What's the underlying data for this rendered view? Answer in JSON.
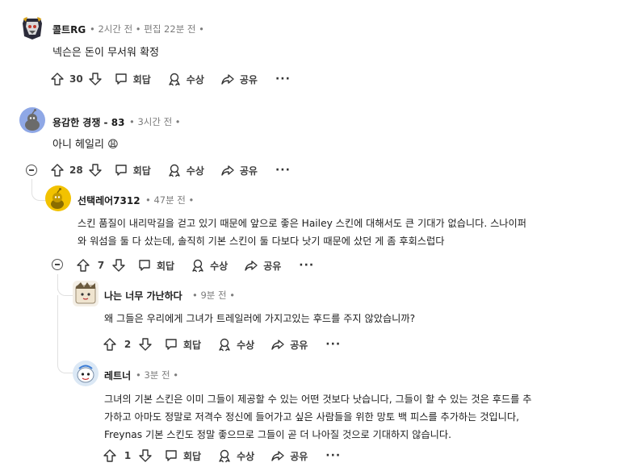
{
  "comments": [
    {
      "author": "콜트RG",
      "meta": "• 2시간 전 • 편집 22분 전 •",
      "body": "넥슨은 돈이 무서워 확정",
      "votes": "30",
      "reply": "회답",
      "award": "수상",
      "share": "공유",
      "more": "···"
    },
    {
      "author": "용감한 경쟁 - 83",
      "meta": "• 3시간 전 •",
      "body": "아니 헤일리 😩",
      "votes": "28",
      "reply": "회답",
      "award": "수상",
      "share": "공유",
      "more": "···"
    },
    {
      "author": "선택레어7312",
      "meta": "• 47분 전 •",
      "body_line1": "스킨 품질이 내리막길을 걷고 있기 때문에 앞으로 좋은 Hailey 스킨에 대해서도 큰 기대가 없습니다. 스나이퍼",
      "body_line2": "와 워섬을 둘 다 샀는데, 솔직히 기본 스킨이 둘 다보다 낫기 때문에 샀던 게 좀 후회스럽다",
      "votes": "7",
      "reply": "회답",
      "award": "수상",
      "share": "공유",
      "more": "···"
    },
    {
      "author": "나는 너무 가난하다",
      "meta": "• 9분 전 •",
      "body": "왜 그들은 우리에게 그녀가 트레일러에 가지고있는 후드를 주지 않았습니까?",
      "votes": "2",
      "reply": "회답",
      "award": "수상",
      "share": "공유",
      "more": "···"
    },
    {
      "author": "레트너",
      "meta": "• 3분 전 •",
      "body_line1": "그녀의 기본 스킨은 이미 그들이 제공할 수 있는 어떤 것보다 낫습니다, 그들이 할 수 있는 것은 후드를 추",
      "body_line2": "가하고 아마도 정말로 저격수 정신에 들어가고 싶은 사람들을 위한 망토 백 피스를 추가하는 것입니다,",
      "body_line3": "Freynas 기본 스킨도 정말 좋으므로 그들이 곧 더 나아질 것으로 기대하지 않습니다.",
      "votes": "1",
      "reply": "회답",
      "award": "수상",
      "share": "공유",
      "more": "···"
    }
  ],
  "icons": {
    "upvote": "upvote-arrow-icon",
    "downvote": "downvote-arrow-icon",
    "reply": "speech-bubble-icon",
    "award": "award-ribbon-icon",
    "share": "share-arrow-icon",
    "collapse": "collapse-minus-icon"
  },
  "colors": {
    "avatar_1": "#2b2b3a",
    "avatar_2": "#8fa8e6",
    "avatar_3": "#f2c200",
    "avatar_5": "#dbe8f5",
    "emoji": "#e8323a"
  }
}
